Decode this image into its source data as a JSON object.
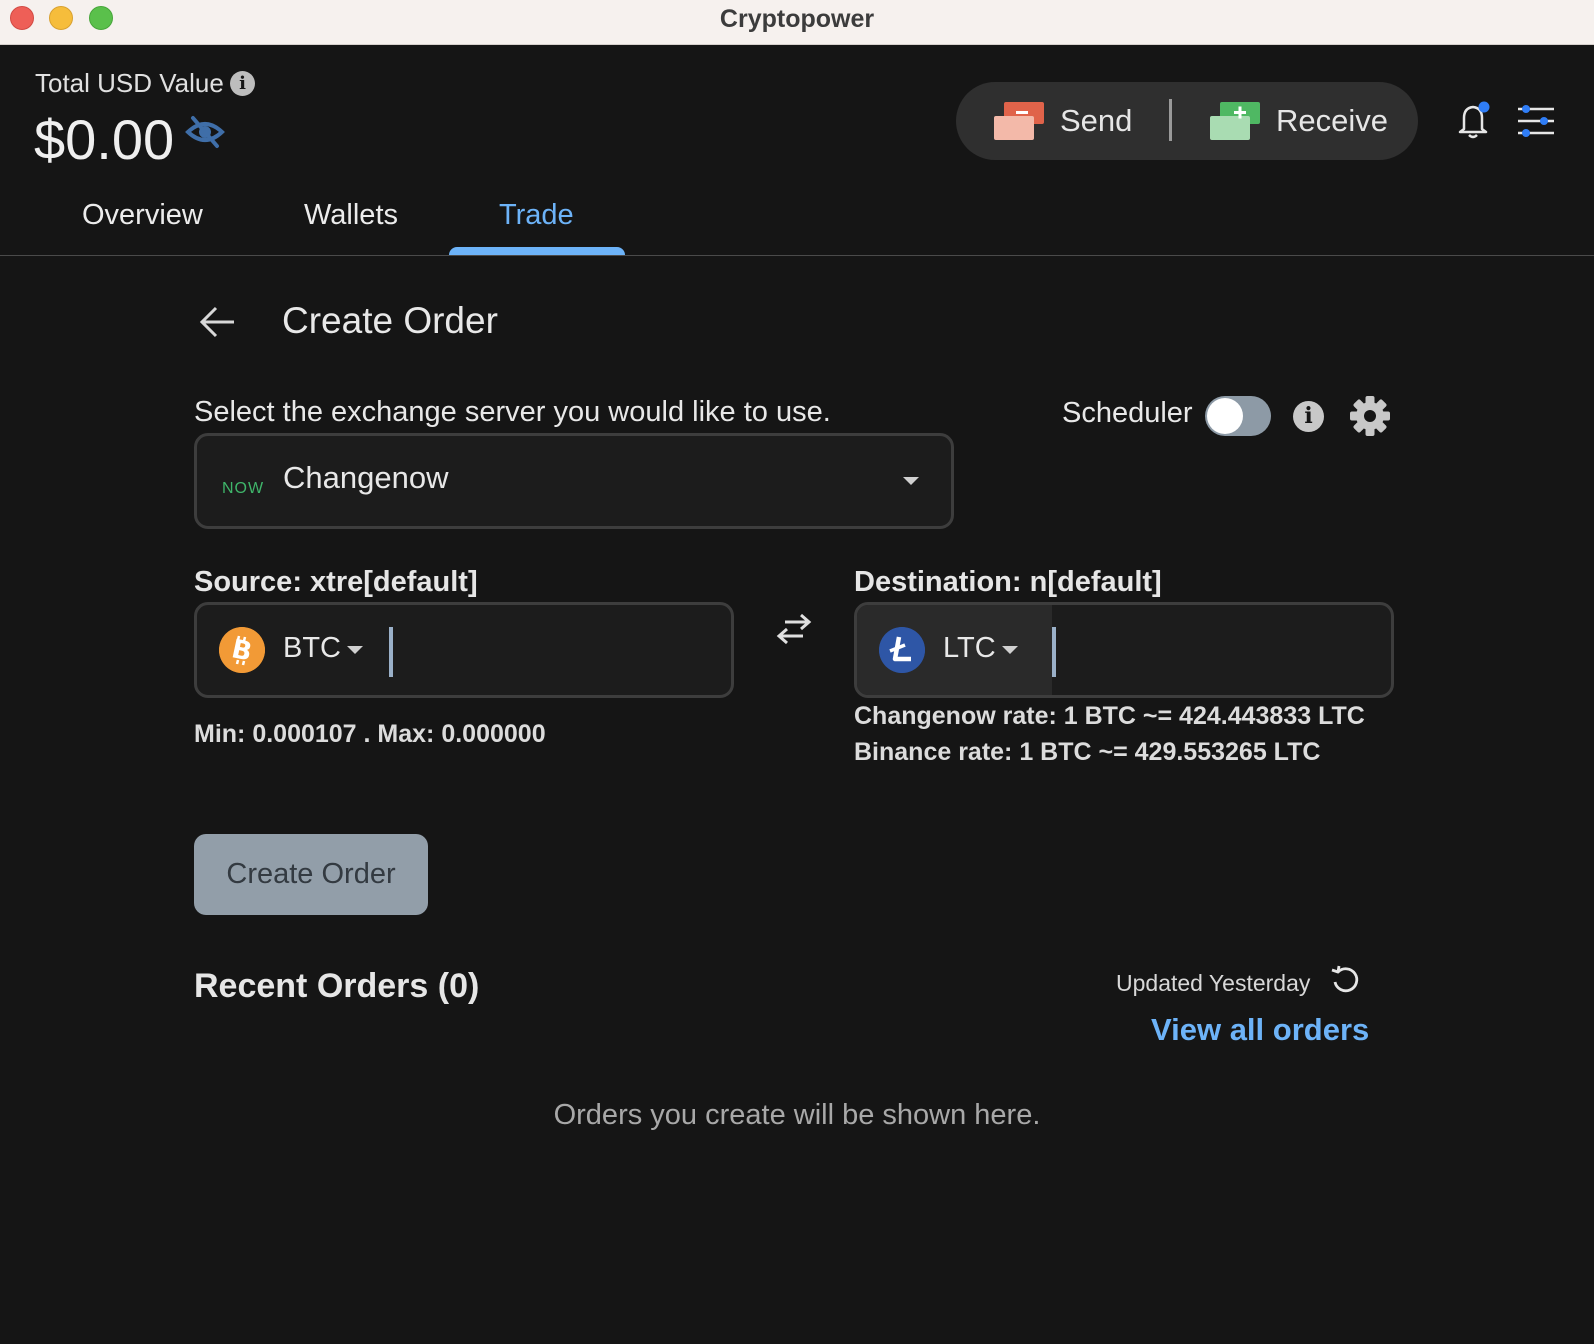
{
  "window": {
    "title": "Cryptopower"
  },
  "header": {
    "total_label": "Total USD Value",
    "total_value": "$0.00",
    "send_label": "Send",
    "receive_label": "Receive"
  },
  "tabs": [
    {
      "label": "Overview",
      "active": false
    },
    {
      "label": "Wallets",
      "active": false
    },
    {
      "label": "Trade",
      "active": true
    }
  ],
  "page": {
    "title": "Create Order",
    "select_server_label": "Select the exchange server you would like to use.",
    "scheduler_label": "Scheduler",
    "scheduler_on": false,
    "exchange": {
      "logo_text": "NOW",
      "name": "Changenow"
    }
  },
  "source": {
    "label": "Source: xtre[default]",
    "coin": "BTC",
    "amount": "",
    "limits": "Min: 0.000107 . Max: 0.000000"
  },
  "destination": {
    "label": "Destination: n[default]",
    "coin": "LTC",
    "amount": "",
    "rates": [
      "Changenow rate: 1 BTC ~= 424.443833 LTC",
      "Binance rate: 1 BTC ~= 429.553265 LTC"
    ]
  },
  "actions": {
    "create_order_label": "Create Order"
  },
  "recent_orders": {
    "title": "Recent Orders (0)",
    "updated": "Updated Yesterday",
    "view_all": "View all orders",
    "empty_message": "Orders you create will be shown here."
  },
  "colors": {
    "accent": "#6db3f8",
    "background": "#151515",
    "send": "#e0634a",
    "receive": "#4fb863",
    "btc": "#f29a36",
    "ltc": "#2e56a6"
  }
}
